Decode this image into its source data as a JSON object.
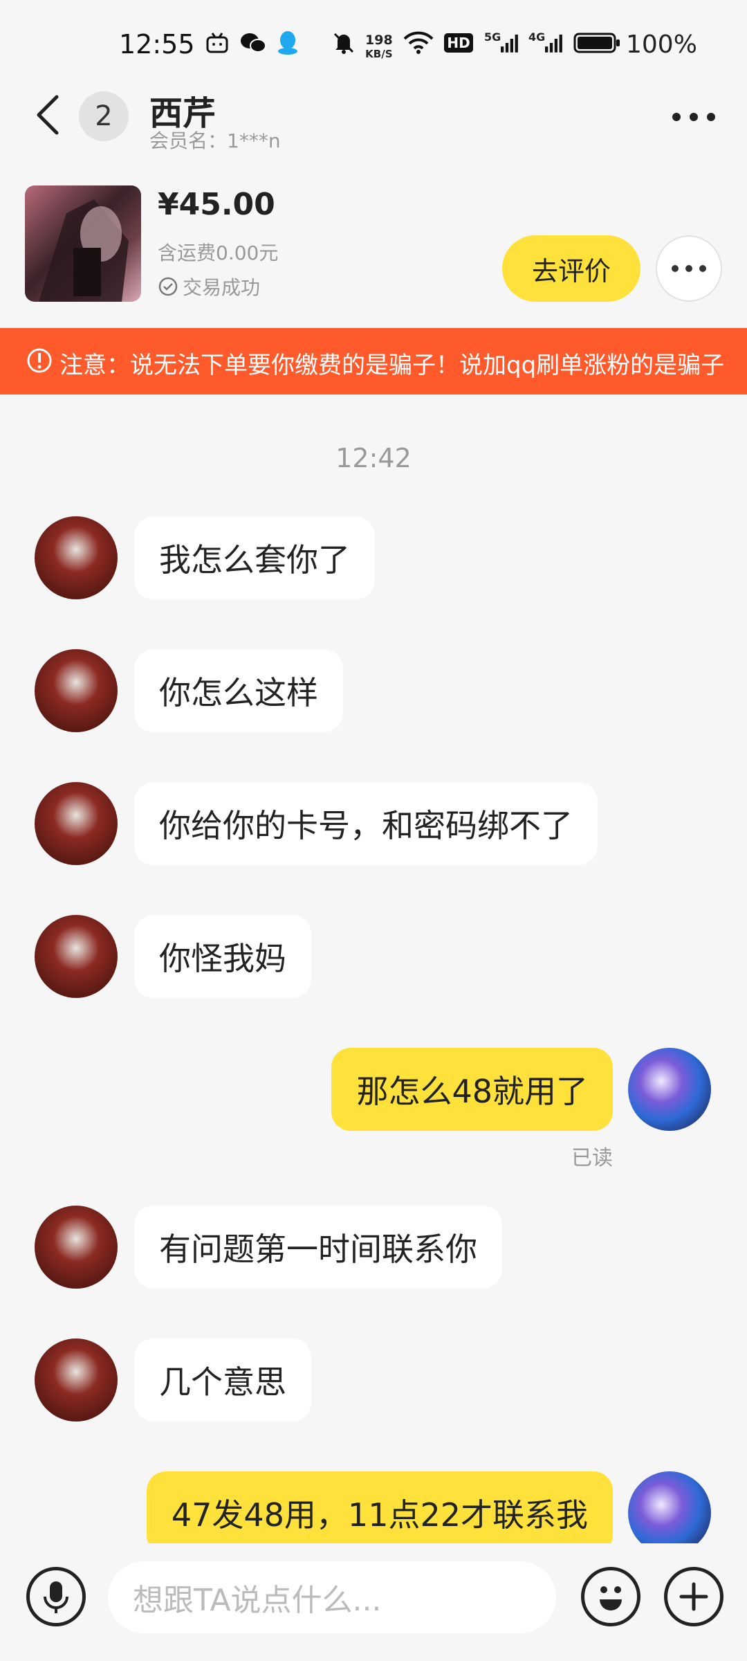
{
  "status_bar": {
    "time": "12:55",
    "net_speed_value": "198",
    "net_speed_unit": "KB/S",
    "hd_label": "HD",
    "sig1_label": "5G",
    "sig2_label": "4G",
    "battery": "100%",
    "icons": [
      "bilibili-icon",
      "wechat-icon",
      "qq-icon",
      "mute-icon",
      "wifi-icon",
      "hd-icon",
      "signal-5g-icon",
      "signal-4g-icon",
      "battery-icon"
    ]
  },
  "header": {
    "unread_count": "2",
    "title": "西芹",
    "member_label": "会员名：1***n"
  },
  "product": {
    "price": "¥45.00",
    "shipping": "含运费0.00元",
    "status": "交易成功",
    "review_button": "去评价"
  },
  "warning": {
    "text": "注意：说无法下单要你缴费的是骗子！说加qq刷单涨粉的是骗子"
  },
  "chat": {
    "timestamp": "12:42",
    "messages": [
      {
        "from": "them",
        "text": "我怎么套你了"
      },
      {
        "from": "them",
        "text": "你怎么这样"
      },
      {
        "from": "them",
        "text": "你给你的卡号，和密码绑不了"
      },
      {
        "from": "them",
        "text": "你怪我妈"
      },
      {
        "from": "me",
        "text": "那怎么48就用了",
        "status": "已读"
      },
      {
        "from": "them",
        "text": "有问题第一时间联系你"
      },
      {
        "from": "them",
        "text": "几个意思"
      },
      {
        "from": "me",
        "text": "47发48用，11点22才联系我"
      }
    ]
  },
  "input_bar": {
    "placeholder": "想跟TA说点什么..."
  },
  "colors": {
    "accent_yellow": "#ffe13b",
    "warning_orange": "#ff5a2b",
    "background": "#f6f6f6"
  }
}
